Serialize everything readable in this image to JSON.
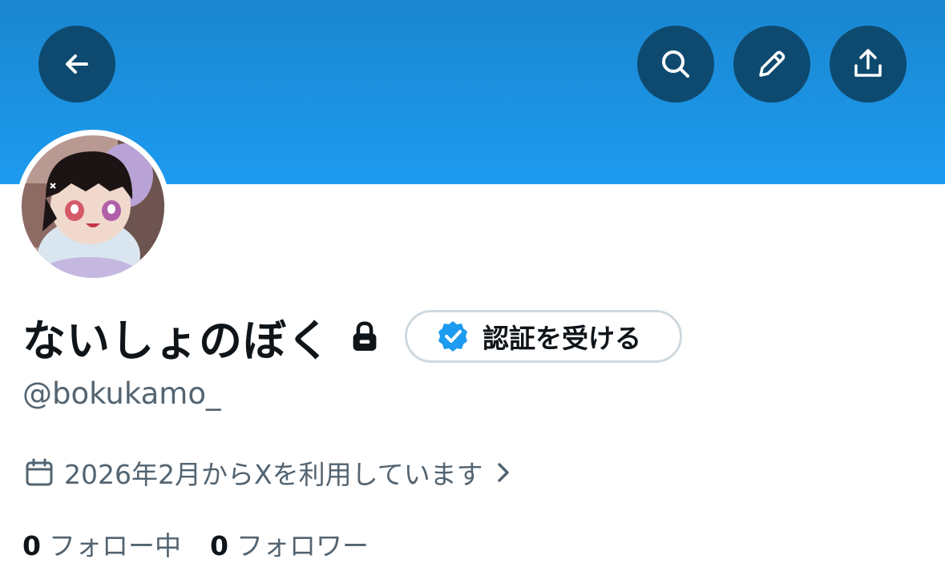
{
  "profile": {
    "display_name": "ないしょのぼく",
    "handle": "@bokukamo_",
    "verify_label": "認証を受ける",
    "joined": "2026年2月からXを利用しています",
    "following_count": "0",
    "following_label": "フォロー中",
    "followers_count": "0",
    "followers_label": "フォロワー"
  },
  "header": {
    "buttons": [
      "back-icon",
      "search-icon",
      "edit-icon",
      "share-icon"
    ]
  },
  "colors": {
    "banner": "#1d9bf0",
    "button_bg": "#0e4a70",
    "verified_blue": "#1d9bf0",
    "secondary_text": "#536471"
  }
}
